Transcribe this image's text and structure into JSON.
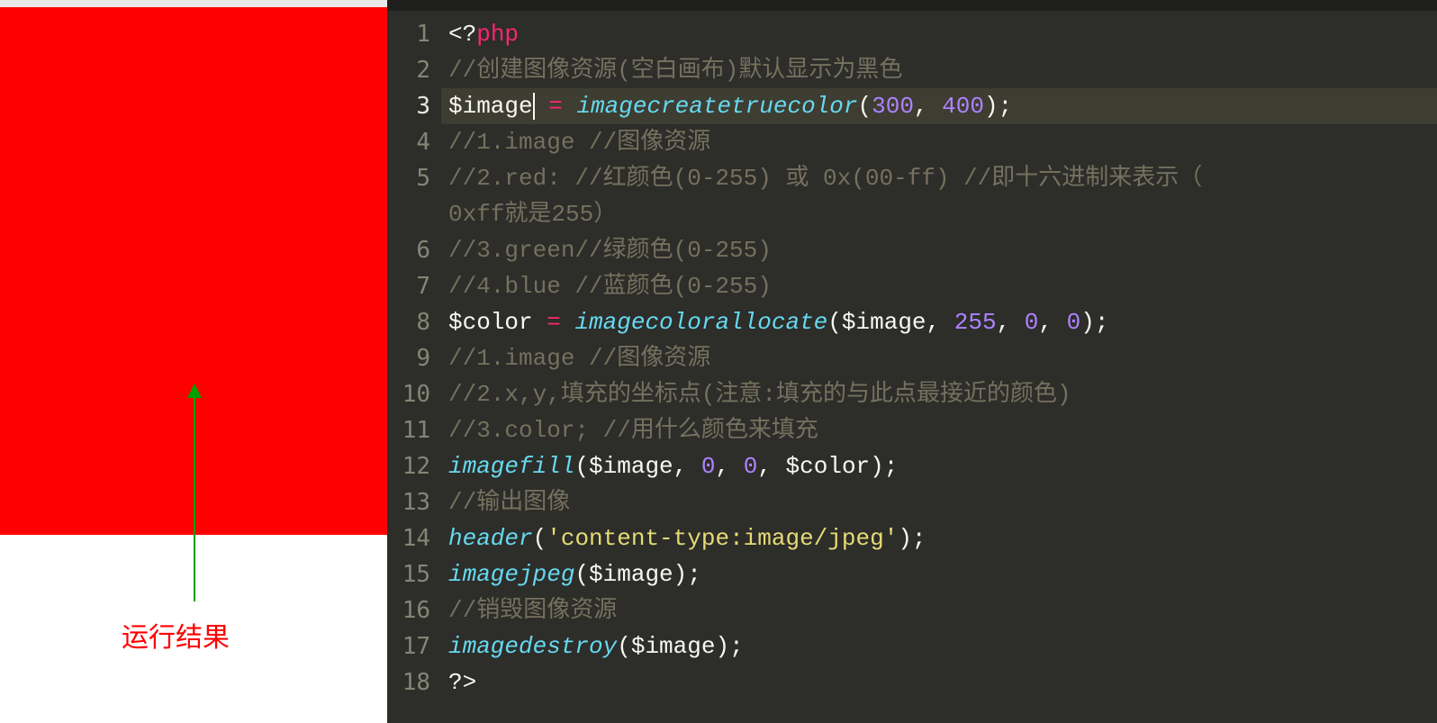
{
  "result_label": "运行结果",
  "canvas_color": "#ff0000",
  "code": {
    "line1": {
      "open": "<?",
      "php": "php"
    },
    "line2": {
      "comment": "//创建图像资源(空白画布)默认显示为黑色"
    },
    "line3": {
      "var": "$image",
      "op": " = ",
      "func": "imagecreatetruecolor",
      "lp": "(",
      "n1": "300",
      "c1": ", ",
      "n2": "400",
      "rp": ")",
      "sc": ";"
    },
    "line4": {
      "comment": "//1.image  //图像资源"
    },
    "line5a": {
      "comment": "//2.red:  //红颜色(0-255)  或  0x(00-ff)  //即十六进制来表示（"
    },
    "line5b": {
      "comment": "0xff就是255）"
    },
    "line6": {
      "comment": "//3.green//绿颜色(0-255)"
    },
    "line7": {
      "comment": "//4.blue  //蓝颜色(0-255)"
    },
    "line8": {
      "var": "$color",
      "op": " = ",
      "func": "imagecolorallocate",
      "lp": "(",
      "a1": "$image",
      "c1": ", ",
      "n1": "255",
      "c2": ", ",
      "n2": "0",
      "c3": ", ",
      "n3": "0",
      "rp": ")",
      "sc": ";"
    },
    "line9": {
      "comment": "//1.image  //图像资源"
    },
    "line10": {
      "comment": "//2.x,y,填充的坐标点(注意:填充的与此点最接近的颜色)"
    },
    "line11": {
      "comment": "//3.color;  //用什么颜色来填充"
    },
    "line12": {
      "func": "imagefill",
      "lp": "(",
      "a1": "$image",
      "c1": ", ",
      "n1": "0",
      "c2": ", ",
      "n2": "0",
      "c3": ", ",
      "a2": "$color",
      "rp": ")",
      "sc": ";"
    },
    "line13": {
      "comment": "//输出图像"
    },
    "line14": {
      "func": "header",
      "lp": "(",
      "str": "'content-type:image/jpeg'",
      "rp": ")",
      "sc": ";"
    },
    "line15": {
      "func": "imagejpeg",
      "lp": "(",
      "a1": "$image",
      "rp": ")",
      "sc": ";"
    },
    "line16": {
      "comment": "//销毁图像资源"
    },
    "line17": {
      "func": "imagedestroy",
      "lp": "(",
      "a1": "$image",
      "rp": ")",
      "sc": ";"
    },
    "line18": {
      "close": "?>"
    }
  },
  "line_numbers": [
    "1",
    "2",
    "3",
    "4",
    "5",
    "6",
    "7",
    "8",
    "9",
    "10",
    "11",
    "12",
    "13",
    "14",
    "15",
    "16",
    "17",
    "18"
  ],
  "wrapped_indent": "    "
}
